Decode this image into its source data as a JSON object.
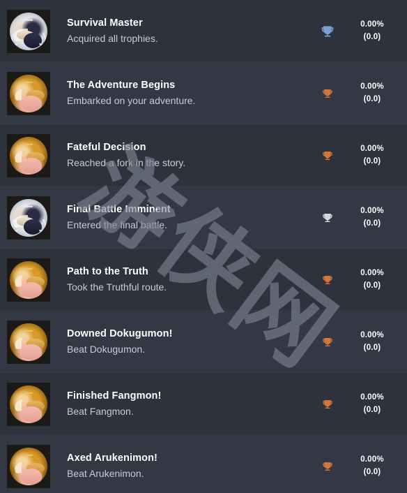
{
  "theme": {
    "page_background": "#2e323d",
    "row_background": "#2e323d",
    "row_background_alt": "#343845",
    "title_color": "#ffffff",
    "description_color": "#c8cbd4",
    "rate_color": "#ffffff",
    "trophy_platinum_color": "#7b9fd4",
    "trophy_silver_color": "#d5d7dd",
    "trophy_bronze_color": "#d4763a",
    "watermark_color": "#7e8591"
  },
  "watermark": {
    "text": "游侠网",
    "rotation_degrees": 37
  },
  "achievements": [
    {
      "title": "Survival Master",
      "description": "Acquired all trophies.",
      "trophy": "platinum-trophy-icon",
      "thumbnail": "platinum-laurel-badge",
      "rate_percent": "0.00%",
      "rate_count": "(0.0)"
    },
    {
      "title": "The Adventure Begins",
      "description": "Embarked on your adventure.",
      "trophy": "bronze-trophy-icon",
      "thumbnail": "gold-badge",
      "rate_percent": "0.00%",
      "rate_count": "(0.0)"
    },
    {
      "title": "Fateful Decision",
      "description": "Reached a fork in the story.",
      "trophy": "bronze-trophy-icon",
      "thumbnail": "gold-badge",
      "rate_percent": "0.00%",
      "rate_count": "(0.0)"
    },
    {
      "title": "Final Battle Imminent",
      "description": "Entered the final battle.",
      "trophy": "silver-trophy-icon",
      "thumbnail": "platinum-laurel-badge",
      "rate_percent": "0.00%",
      "rate_count": "(0.0)"
    },
    {
      "title": "Path to the Truth",
      "description": "Took the Truthful route.",
      "trophy": "bronze-trophy-icon",
      "thumbnail": "gold-badge",
      "rate_percent": "0.00%",
      "rate_count": "(0.0)"
    },
    {
      "title": "Downed Dokugumon!",
      "description": "Beat Dokugumon.",
      "trophy": "bronze-trophy-icon",
      "thumbnail": "gold-badge",
      "rate_percent": "0.00%",
      "rate_count": "(0.0)"
    },
    {
      "title": "Finished Fangmon!",
      "description": "Beat Fangmon.",
      "trophy": "bronze-trophy-icon",
      "thumbnail": "gold-badge",
      "rate_percent": "0.00%",
      "rate_count": "(0.0)"
    },
    {
      "title": "Axed Arukenimon!",
      "description": "Beat Arukenimon.",
      "trophy": "bronze-trophy-icon",
      "thumbnail": "gold-badge",
      "rate_percent": "0.00%",
      "rate_count": "(0.0)"
    }
  ]
}
